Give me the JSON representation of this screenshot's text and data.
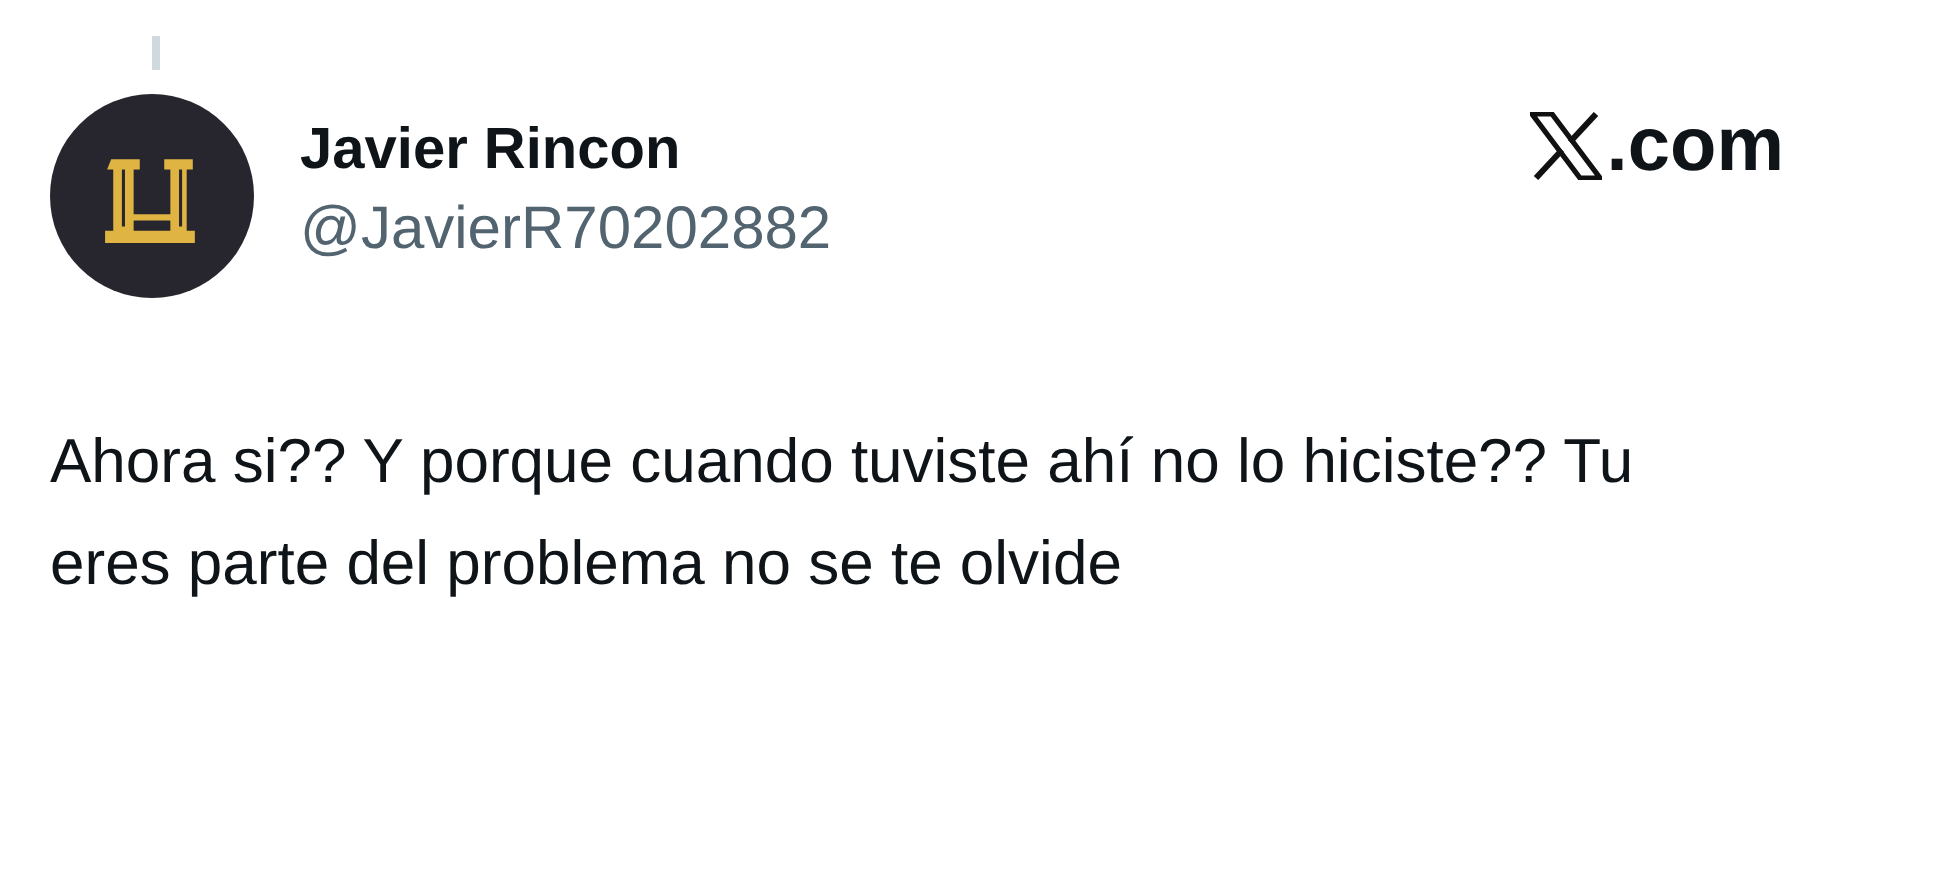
{
  "author": {
    "name": "Javier Rincon",
    "handle": "@JavierR70202882"
  },
  "source": {
    "domain": ".com"
  },
  "tweet": {
    "text": "Ahora si?? Y porque cuando tuviste ahí no lo hiciste?? Tu eres parte del problema no se te olvide"
  }
}
